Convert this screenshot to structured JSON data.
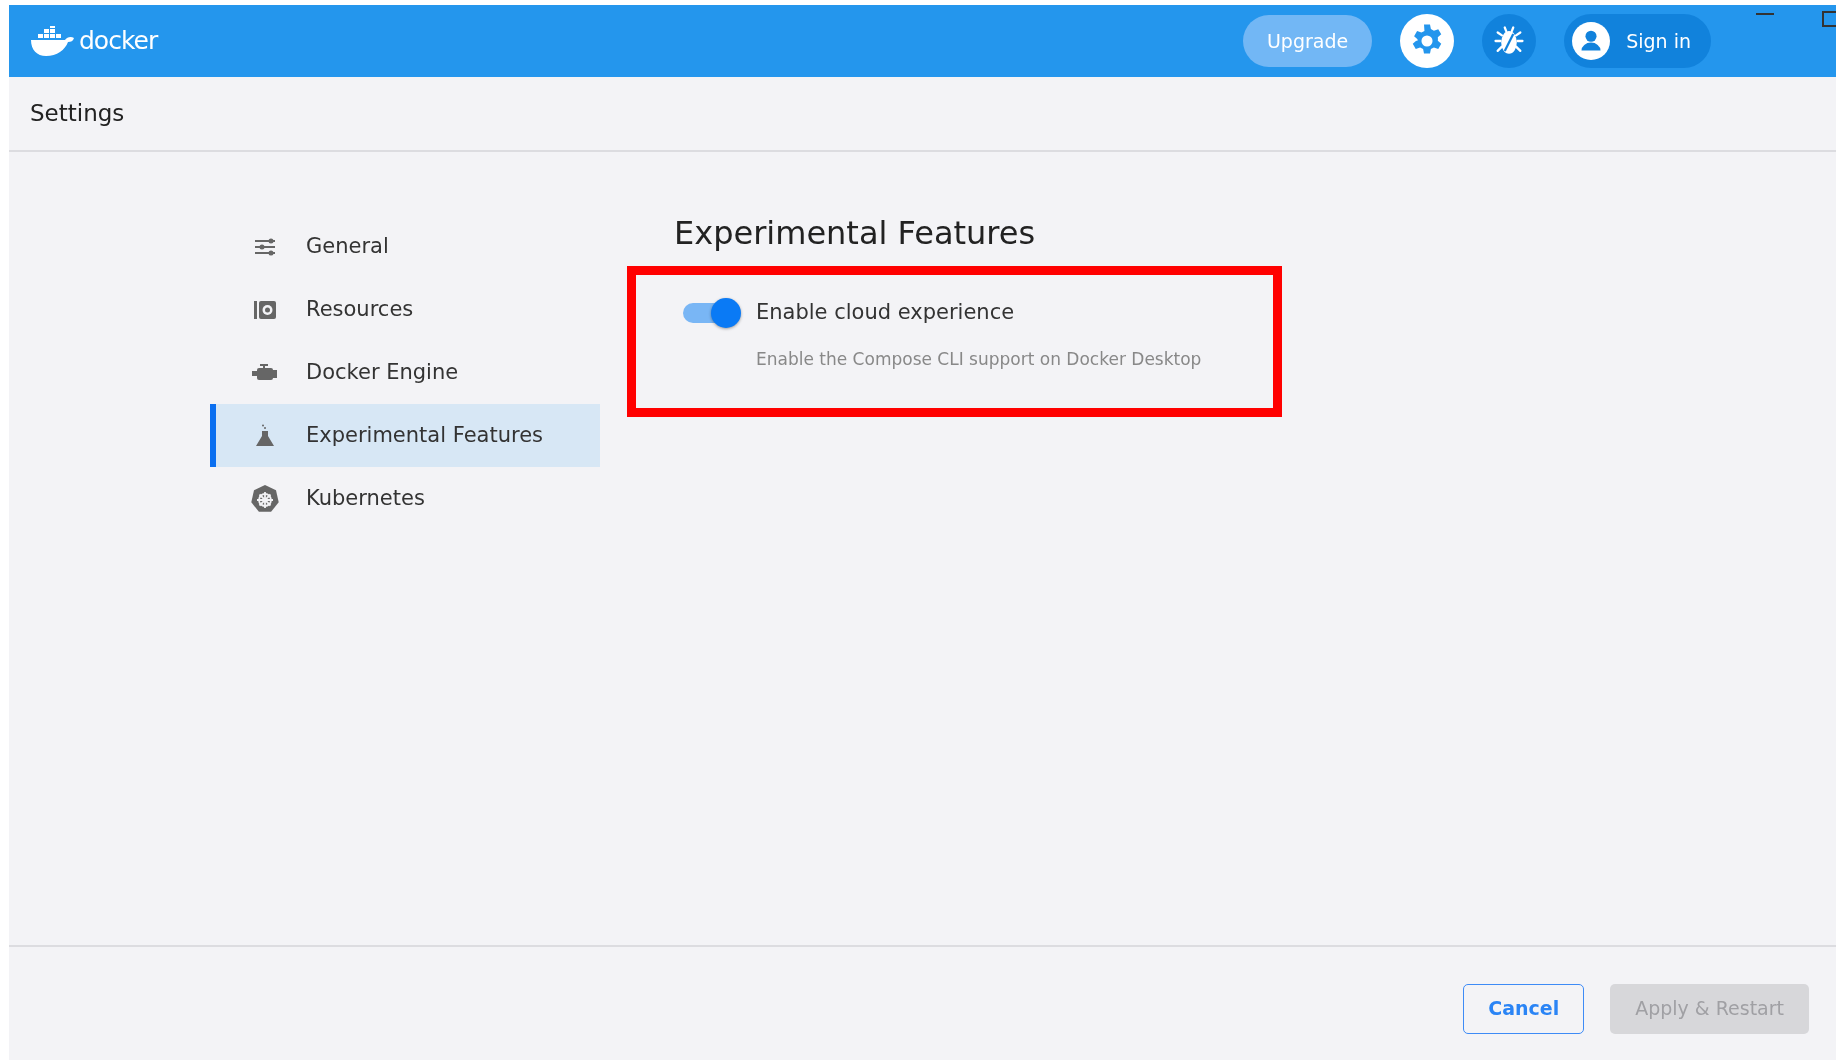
{
  "header": {
    "logo": "docker",
    "upgrade": "Upgrade",
    "sign_in": "Sign in"
  },
  "page_title": "Settings",
  "sidebar": {
    "items": [
      {
        "label": "General",
        "selected": false
      },
      {
        "label": "Resources",
        "selected": false
      },
      {
        "label": "Docker Engine",
        "selected": false
      },
      {
        "label": "Experimental Features",
        "selected": true
      },
      {
        "label": "Kubernetes",
        "selected": false
      }
    ]
  },
  "section": {
    "title": "Experimental Features",
    "settings": [
      {
        "label": "Enable cloud experience",
        "description": "Enable the Compose CLI support on Docker Desktop",
        "on": true,
        "highlighted": true
      }
    ]
  },
  "buttons": [
    {
      "label": "Cancel",
      "disabled": false
    },
    {
      "label": "Apply & Restart",
      "disabled": true
    }
  ]
}
